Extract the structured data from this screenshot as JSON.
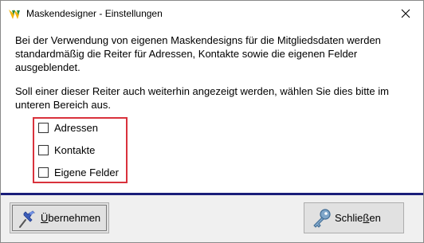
{
  "window": {
    "title": "Maskendesigner - Einstellungen",
    "icon": "app-logo-icon",
    "close_icon": "close-icon"
  },
  "content": {
    "paragraph1": "Bei der Verwendung von eigenen Maskendesigns für die Mitgliedsdaten werden standardmäßig die Reiter für Adressen, Kontakte sowie die eigenen Felder ausgeblendet.",
    "paragraph2": "Soll einer dieser Reiter auch weiterhin angezeigt werden, wählen Sie dies bitte im unteren Bereich aus.",
    "checkboxes": [
      {
        "label": "Adressen",
        "checked": false
      },
      {
        "label": "Kontakte",
        "checked": false
      },
      {
        "label": "Eigene Felder",
        "checked": false
      }
    ],
    "highlight_color": "#d9323c"
  },
  "footer": {
    "apply_button": {
      "label_first": "Ü",
      "label_rest": "bernehmen",
      "icon": "pushpin-icon"
    },
    "close_button": {
      "label_pre": "Schlie",
      "label_accel": "ß",
      "label_post": "en",
      "icon": "key-icon"
    }
  },
  "colors": {
    "separator": "#1a1e7a",
    "footer_bg": "#f0f0f0"
  }
}
